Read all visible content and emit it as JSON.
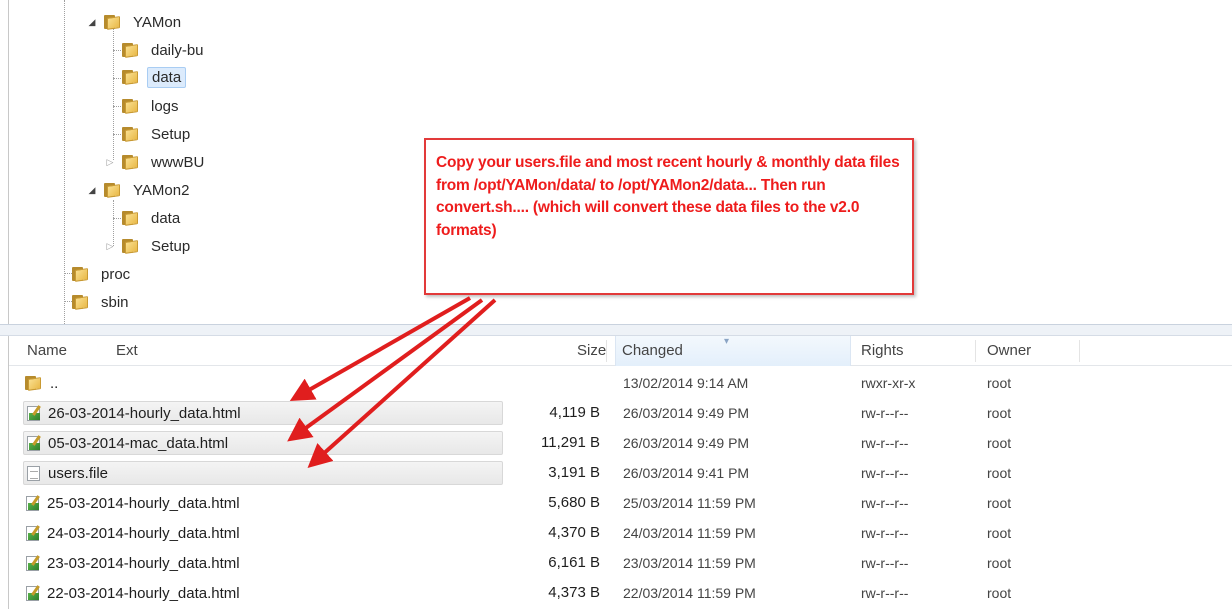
{
  "tree": {
    "nodes": [
      {
        "label": "YAMon",
        "state": "expanded"
      },
      {
        "label": "daily-bu",
        "state": "leaf"
      },
      {
        "label": "data",
        "state": "leaf",
        "selected": true
      },
      {
        "label": "logs",
        "state": "leaf"
      },
      {
        "label": "Setup",
        "state": "leaf"
      },
      {
        "label": "wwwBU",
        "state": "collapsed"
      },
      {
        "label": "YAMon2",
        "state": "expanded"
      },
      {
        "label": "data",
        "state": "leaf"
      },
      {
        "label": "Setup",
        "state": "collapsed"
      },
      {
        "label": "proc",
        "state": "leaf"
      },
      {
        "label": "sbin",
        "state": "leaf"
      }
    ]
  },
  "callout": {
    "text": "Copy your users.file and most recent hourly & monthly data files from /opt/YAMon/data/ to /opt/YAMon2/data...    Then run convert.sh.... (which will convert these data files to the v2.0 formats)",
    "color": "#ee1c1c"
  },
  "list": {
    "headers": {
      "name": "Name",
      "ext": "Ext",
      "size": "Size",
      "changed": "Changed",
      "rights": "Rights",
      "owner": "Owner"
    },
    "rows": [
      {
        "name": "..",
        "icon": "parent-folder-icon",
        "size": "",
        "changed": "13/02/2014 9:14 AM",
        "rights": "rwxr-xr-x",
        "owner": "root"
      },
      {
        "name": "26-03-2014-hourly_data.html",
        "icon": "html-file-icon",
        "size": "4,119 B",
        "changed": "26/03/2014 9:49 PM",
        "rights": "rw-r--r--",
        "owner": "root",
        "highlighted": true
      },
      {
        "name": "05-03-2014-mac_data.html",
        "icon": "html-file-icon",
        "size": "11,291 B",
        "changed": "26/03/2014 9:49 PM",
        "rights": "rw-r--r--",
        "owner": "root",
        "highlighted": true
      },
      {
        "name": "users.file",
        "icon": "text-file-icon",
        "size": "3,191 B",
        "changed": "26/03/2014 9:41 PM",
        "rights": "rw-r--r--",
        "owner": "root",
        "highlighted": true
      },
      {
        "name": "25-03-2014-hourly_data.html",
        "icon": "html-file-icon",
        "size": "5,680 B",
        "changed": "25/03/2014 11:59 PM",
        "rights": "rw-r--r--",
        "owner": "root"
      },
      {
        "name": "24-03-2014-hourly_data.html",
        "icon": "html-file-icon",
        "size": "4,370 B",
        "changed": "24/03/2014 11:59 PM",
        "rights": "rw-r--r--",
        "owner": "root"
      },
      {
        "name": "23-03-2014-hourly_data.html",
        "icon": "html-file-icon",
        "size": "6,161 B",
        "changed": "23/03/2014 11:59 PM",
        "rights": "rw-r--r--",
        "owner": "root"
      },
      {
        "name": "22-03-2014-hourly_data.html",
        "icon": "html-file-icon",
        "size": "4,373 B",
        "changed": "22/03/2014 11:59 PM",
        "rights": "rw-r--r--",
        "owner": "root"
      }
    ]
  },
  "colors": {
    "arrow": "#e01e1e",
    "selection": "#dcebfc"
  }
}
